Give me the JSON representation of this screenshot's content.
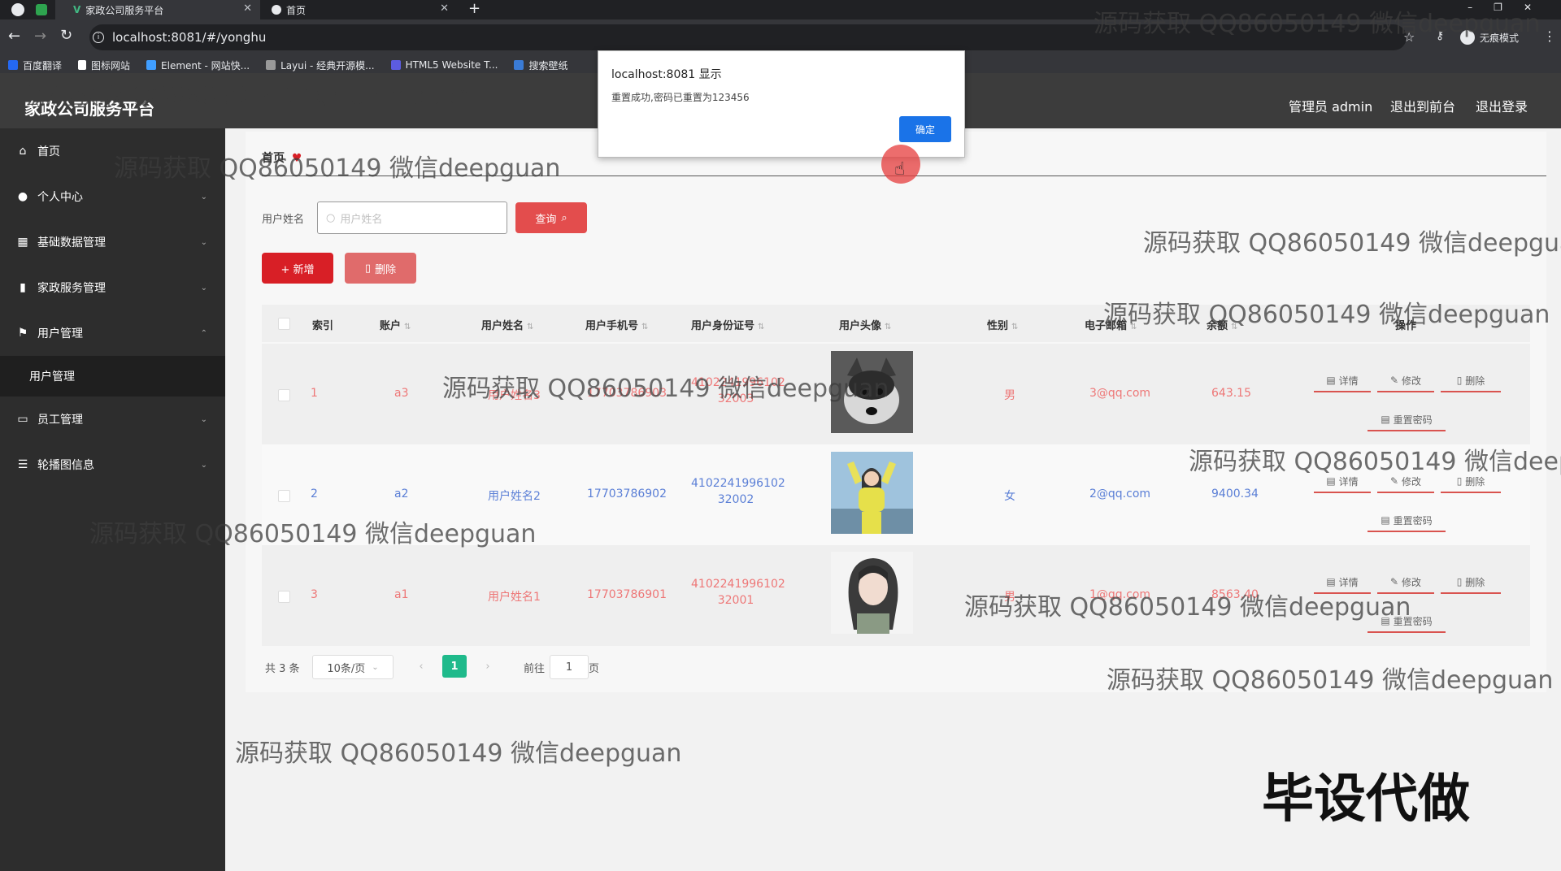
{
  "browser": {
    "tabs": [
      {
        "title": "家政公司服务平台",
        "active": true
      },
      {
        "title": "首页",
        "active": false
      }
    ],
    "new_tab": "+",
    "url": "localhost:8081/#/yonghu",
    "incognito_label": "无痕模式",
    "bookmarks": [
      {
        "label": "百度翻译",
        "color": "#2468f2"
      },
      {
        "label": "图标网站",
        "color": "#ffffff"
      },
      {
        "label": "Element - 网站快...",
        "color": "#409eff"
      },
      {
        "label": "Layui - 经典开源模...",
        "color": "#999999"
      },
      {
        "label": "HTML5 Website T...",
        "color": "#5c5ce0"
      },
      {
        "label": "搜索壁纸",
        "color": "#3a7bd5"
      }
    ]
  },
  "header": {
    "title": "家政公司服务平台",
    "user": "管理员 admin",
    "to_front": "退出到前台",
    "logout": "退出登录"
  },
  "sidebar": {
    "items": [
      {
        "label": "首页",
        "icon": "home-icon",
        "chevron": ""
      },
      {
        "label": "个人中心",
        "icon": "user-icon",
        "chevron": "⌄"
      },
      {
        "label": "基础数据管理",
        "icon": "grid-icon",
        "chevron": "⌄"
      },
      {
        "label": "家政服务管理",
        "icon": "bar-icon",
        "chevron": "⌄"
      },
      {
        "label": "用户管理",
        "icon": "flag-icon",
        "chevron": "⌃"
      },
      {
        "label": "员工管理",
        "icon": "card-icon",
        "chevron": "⌄"
      },
      {
        "label": "轮播图信息",
        "icon": "list-icon",
        "chevron": "⌄"
      }
    ],
    "submenu": "用户管理"
  },
  "breadcrumb": {
    "home": "首页"
  },
  "search": {
    "label": "用户姓名",
    "placeholder": "用户姓名",
    "button": "查询"
  },
  "actions": {
    "add": "+ 新增",
    "delete": "删除"
  },
  "table": {
    "headers": [
      "索引",
      "账户",
      "用户姓名",
      "用户手机号",
      "用户身份证号",
      "用户头像",
      "性别",
      "电子邮箱",
      "余额",
      "操作"
    ],
    "rows": [
      {
        "index": "1",
        "account": "a3",
        "name": "用户姓名3",
        "phone": "17703786903",
        "id1": "4102241996102",
        "id2": "32003",
        "gender": "男",
        "email": "3@qq.com",
        "balance": "643.15",
        "avatar": "dog"
      },
      {
        "index": "2",
        "account": "a2",
        "name": "用户姓名2",
        "phone": "17703786902",
        "id1": "4102241996102",
        "id2": "32002",
        "gender": "女",
        "email": "2@qq.com",
        "balance": "9400.34",
        "avatar": "girl-yellow"
      },
      {
        "index": "3",
        "account": "a1",
        "name": "用户姓名1",
        "phone": "17703786901",
        "id1": "4102241996102",
        "id2": "32001",
        "gender": "男",
        "email": "1@qq.com",
        "balance": "8563.40",
        "avatar": "girl-drawing"
      }
    ],
    "ops": {
      "detail": "详情",
      "edit": "修改",
      "delete": "删除",
      "reset": "重置密码"
    }
  },
  "pagination": {
    "total": "共 3 条",
    "page_size": "10条/页",
    "current": "1",
    "goto_label": "前往",
    "goto_value": "1",
    "page_unit": "页"
  },
  "dialog": {
    "title": "localhost:8081 显示",
    "message": "重置成功,密码已重置为123456",
    "ok": "确定"
  },
  "watermarks": {
    "text": "源码获取 QQ86050149 微信deepguan",
    "big": "毕设代做"
  }
}
